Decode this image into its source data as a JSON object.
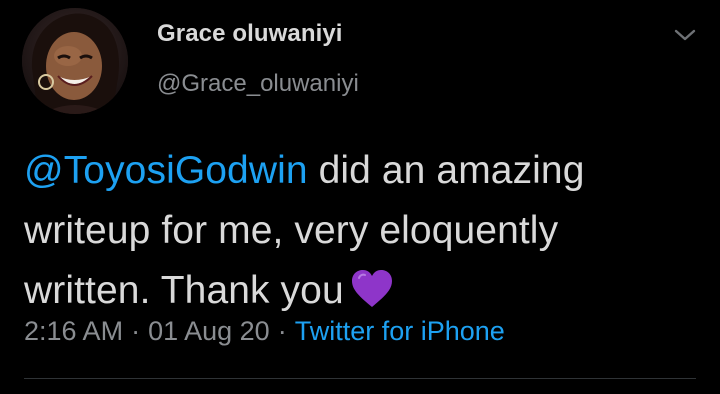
{
  "author": {
    "display_name": "Grace oluwaniyi",
    "handle": "@Grace_oluwaniyi",
    "avatar_icon": "profile-photo"
  },
  "tweet": {
    "mention": "@ToyosiGodwin",
    "line1_rest": " did an amazing",
    "line2": "writeup for me, very eloquently",
    "line3": "written. Thank you",
    "emoji": "purple-heart"
  },
  "meta": {
    "time": "2:16 AM",
    "separator": "·",
    "date": "01 Aug 20",
    "source": "Twitter for iPhone"
  },
  "colors": {
    "background": "#000000",
    "text": "#d9d9d9",
    "secondary": "#8a8d91",
    "link": "#1da1f2",
    "heart": "#8e35c9"
  }
}
